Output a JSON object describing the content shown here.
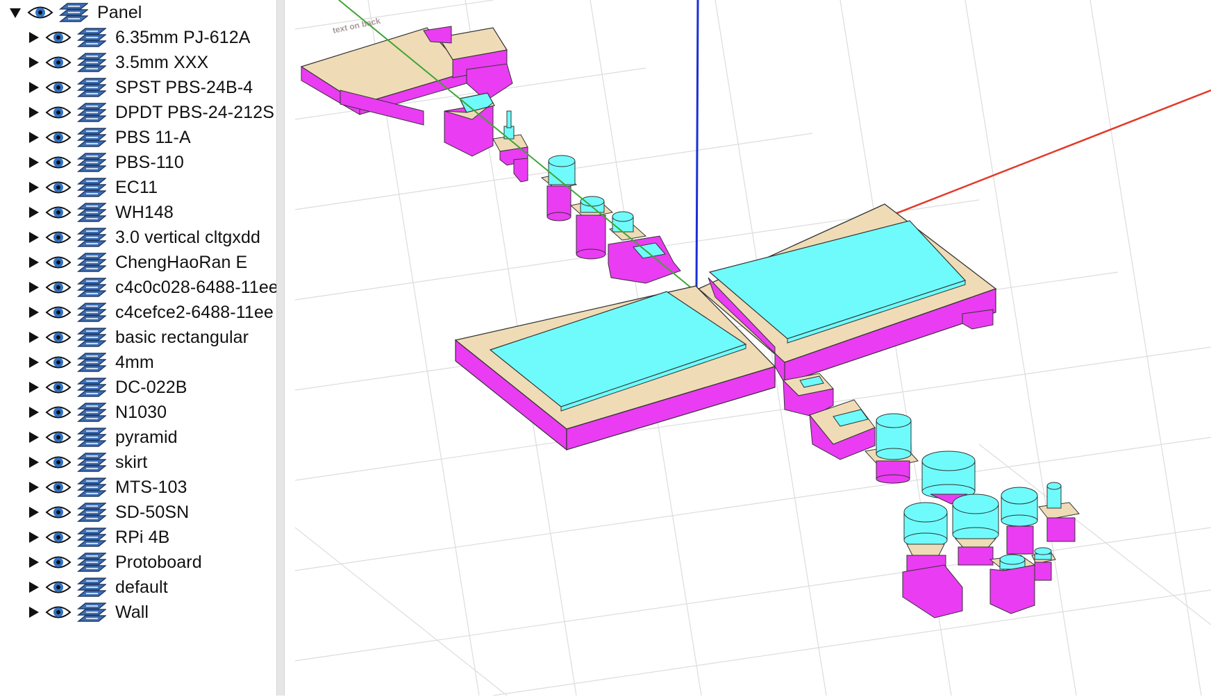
{
  "tree": {
    "root": {
      "label": "Panel",
      "expanded": true
    },
    "items": [
      {
        "label": "6.35mm PJ-612A"
      },
      {
        "label": "3.5mm XXX"
      },
      {
        "label": "SPST PBS-24B-4"
      },
      {
        "label": "DPDT PBS-24-212S"
      },
      {
        "label": "PBS 11-A"
      },
      {
        "label": "PBS-110"
      },
      {
        "label": "EC11"
      },
      {
        "label": "WH148"
      },
      {
        "label": "3.0 vertical cltgxdd"
      },
      {
        "label": "ChengHaoRan E"
      },
      {
        "label": "c4c0c028-6488-11ee"
      },
      {
        "label": "c4cefce2-6488-11ee"
      },
      {
        "label": "basic rectangular"
      },
      {
        "label": "4mm"
      },
      {
        "label": "DC-022B"
      },
      {
        "label": "N1030"
      },
      {
        "label": "pyramid"
      },
      {
        "label": "skirt"
      },
      {
        "label": "MTS-103"
      },
      {
        "label": "SD-50SN"
      },
      {
        "label": "RPi 4B"
      },
      {
        "label": "Protoboard"
      },
      {
        "label": "default"
      },
      {
        "label": "Wall"
      }
    ]
  },
  "icons": {
    "expand": "triangle-right-icon",
    "collapse": "triangle-down-icon",
    "visibility": "eye-icon",
    "layer": "layers-icon"
  },
  "colors": {
    "eye_blue": "#2f72c4",
    "layer_blue": "#3d6fb6",
    "x_axis": "#e23a2a",
    "y_axis": "#3fa535",
    "z_axis": "#1a2fd6",
    "component_top": "#6ffbfb",
    "component_side": "#ea3cf2",
    "board_top": "#efdcb6"
  },
  "viewport": {
    "engraved_text": "text on back"
  }
}
